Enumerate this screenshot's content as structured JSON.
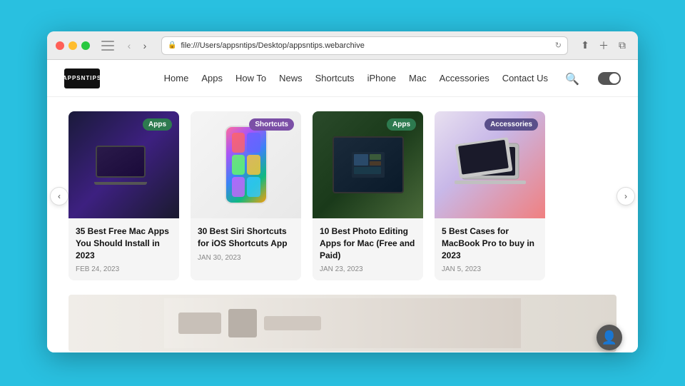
{
  "browser": {
    "address": "file:///Users/appsntips/Desktop/appsntips.webarchive",
    "nav_back": "‹",
    "nav_forward": "›"
  },
  "site": {
    "logo_text": "APPSNTIPS",
    "nav": {
      "links": [
        {
          "label": "Home",
          "key": "home"
        },
        {
          "label": "Apps",
          "key": "apps"
        },
        {
          "label": "How To",
          "key": "howto"
        },
        {
          "label": "News",
          "key": "news"
        },
        {
          "label": "Shortcuts",
          "key": "shortcuts"
        },
        {
          "label": "iPhone",
          "key": "iphone"
        },
        {
          "label": "Mac",
          "key": "mac"
        },
        {
          "label": "Accessories",
          "key": "accessories"
        },
        {
          "label": "Contact Us",
          "key": "contactus"
        }
      ]
    }
  },
  "carousel": {
    "cards": [
      {
        "badge": "Apps",
        "badge_class": "badge-apps",
        "title": "35 Best Free Mac Apps You Should Install in 2023",
        "date": "FEB 24, 2023"
      },
      {
        "badge": "Shortcuts",
        "badge_class": "badge-shortcuts",
        "title": "30 Best Siri Shortcuts for iOS Shortcuts App",
        "date": "JAN 30, 2023"
      },
      {
        "badge": "Apps",
        "badge_class": "badge-apps",
        "title": "10 Best Photo Editing Apps for Mac (Free and Paid)",
        "date": "JAN 23, 2023"
      },
      {
        "badge": "Accessories",
        "badge_class": "badge-accessories",
        "title": "5 Best Cases for MacBook Pro to buy in 2023",
        "date": "JAN 5, 2023"
      }
    ],
    "prev_label": "‹",
    "next_label": "›"
  }
}
